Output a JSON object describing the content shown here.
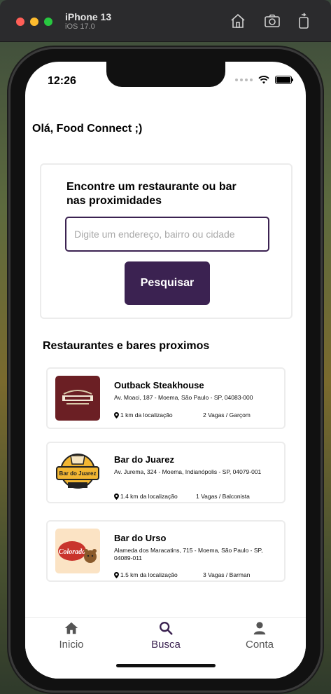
{
  "simulator": {
    "device": "iPhone 13",
    "os": "iOS 17.0",
    "icons": [
      "home-icon",
      "screenshot-icon",
      "rotate-icon"
    ]
  },
  "status_bar": {
    "time": "12:26"
  },
  "greeting": "Olá, Food Connect ;)",
  "search": {
    "title": "Encontre um restaurante ou bar nas proximidades",
    "placeholder": "Digite um endereço, bairro ou cidade",
    "value": "",
    "button_label": "Pesquisar"
  },
  "nearby": {
    "title": "Restaurantes e bares proximos",
    "items": [
      {
        "name": "Outback Steakhouse",
        "address": "Av. Moaci, 187 - Moema, São Paulo - SP, 04083-000",
        "distance": "1 km da localização",
        "vagas": "2 Vagas / Garçom",
        "logo": "outback-logo"
      },
      {
        "name": "Bar do Juarez",
        "address": "Av. Jurema, 324 - Moema, Indianópolis - SP, 04079-001",
        "distance": "1.4 km da localização",
        "vagas": "1 Vagas / Balconista",
        "logo": "bar-do-juarez-logo",
        "logo_text": "Bar do Juarez"
      },
      {
        "name": "Bar do Urso",
        "address": "Alameda dos Maracatins, 715 - Moema, São Paulo - SP, 04089-011",
        "distance": "1.5 km da localização",
        "vagas": "3 Vagas / Barman",
        "logo": "bar-do-urso-logo",
        "logo_text": "Colorado"
      }
    ]
  },
  "tabs": [
    {
      "label": "Inicio",
      "icon": "home-icon",
      "active": false
    },
    {
      "label": "Busca",
      "icon": "search-icon",
      "active": true
    },
    {
      "label": "Conta",
      "icon": "user-icon",
      "active": false
    }
  ],
  "colors": {
    "primary": "#3b2251",
    "outback_red": "#6b1f24",
    "border": "#ececec"
  }
}
